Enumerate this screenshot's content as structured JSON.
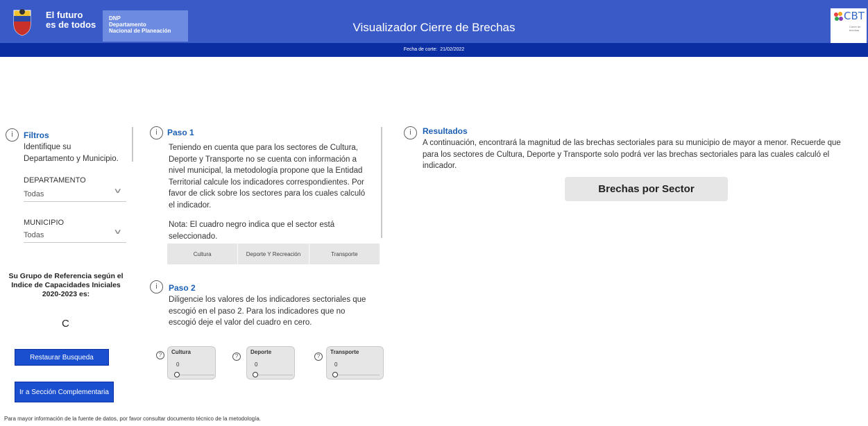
{
  "header": {
    "logo_line1": "El futuro",
    "logo_line2": "es de todos",
    "dnp_abbr": "DNP",
    "dnp_line1": "Departamento",
    "dnp_line2": "Nacional de Planeación",
    "title": "Visualizador Cierre de Brechas",
    "cbt_logo": "CBT",
    "cbt_sub": "Cierre de brechas",
    "date_label": "Fecha de corte:",
    "date_value": "21/02/2022"
  },
  "filtros": {
    "title": "Filtros",
    "desc_line1": "Identifique su",
    "desc_line2": "Departamento y Municipio.",
    "departamento_label": "DEPARTAMENTO",
    "departamento_value": "Todas",
    "municipio_label": "MUNICIPIO",
    "municipio_value": "Todas"
  },
  "grupo": {
    "line1": "Su Grupo de Referencia según el",
    "line2": "Indice de Capacidades Iniciales",
    "line3": "2020-2023 es:",
    "value": "C"
  },
  "buttons": {
    "restaurar": "Restaurar Busqueda",
    "seccion": "Ir a Sección Complementaria"
  },
  "paso1": {
    "title": "Paso 1",
    "lines": [
      " Teniendo en cuenta que para los sectores de Cultura,",
      "Deporte y Transporte no se cuenta con información a",
      "nivel municipal, la metodología propone que la Entidad",
      "Territorial calcule los indicadores correspondientes. Por",
      "favor de click sobre los sectores para los cuales calculó",
      "el indicador."
    ],
    "nota_line1": "Nota: El cuadro negro indica que el sector está",
    "nota_line2": "seleccionado.",
    "sectors": [
      "Cultura",
      "Deporte Y Recreación",
      "Transporte"
    ]
  },
  "paso2": {
    "title": "Paso 2",
    "lines": [
      "Diligencie los valores de los indicadores sectoriales que",
      "escogió en el paso 2. Para los indicadores que no",
      "escogió deje el valor del cuadro en cero."
    ],
    "cards": [
      {
        "title": "Cultura",
        "value": "0"
      },
      {
        "title": "Deporte",
        "value": "0"
      },
      {
        "title": "Transporte",
        "value": "0"
      }
    ]
  },
  "resultados": {
    "title": "Resultados",
    "line1": " A continuación, encontrará la magnitud de las brechas sectoriales para su municipio de mayor a menor. Recuerde que",
    "line2": "para los sectores de Cultura, Deporte y Transporte solo podrá ver las brechas sectoriales para las cuales calculó el",
    "line3": "indicador.",
    "button": "Brechas por Sector"
  },
  "footer": "Para mayor información de la fuente de datos, por favor consultar documento técnico de la metodología."
}
